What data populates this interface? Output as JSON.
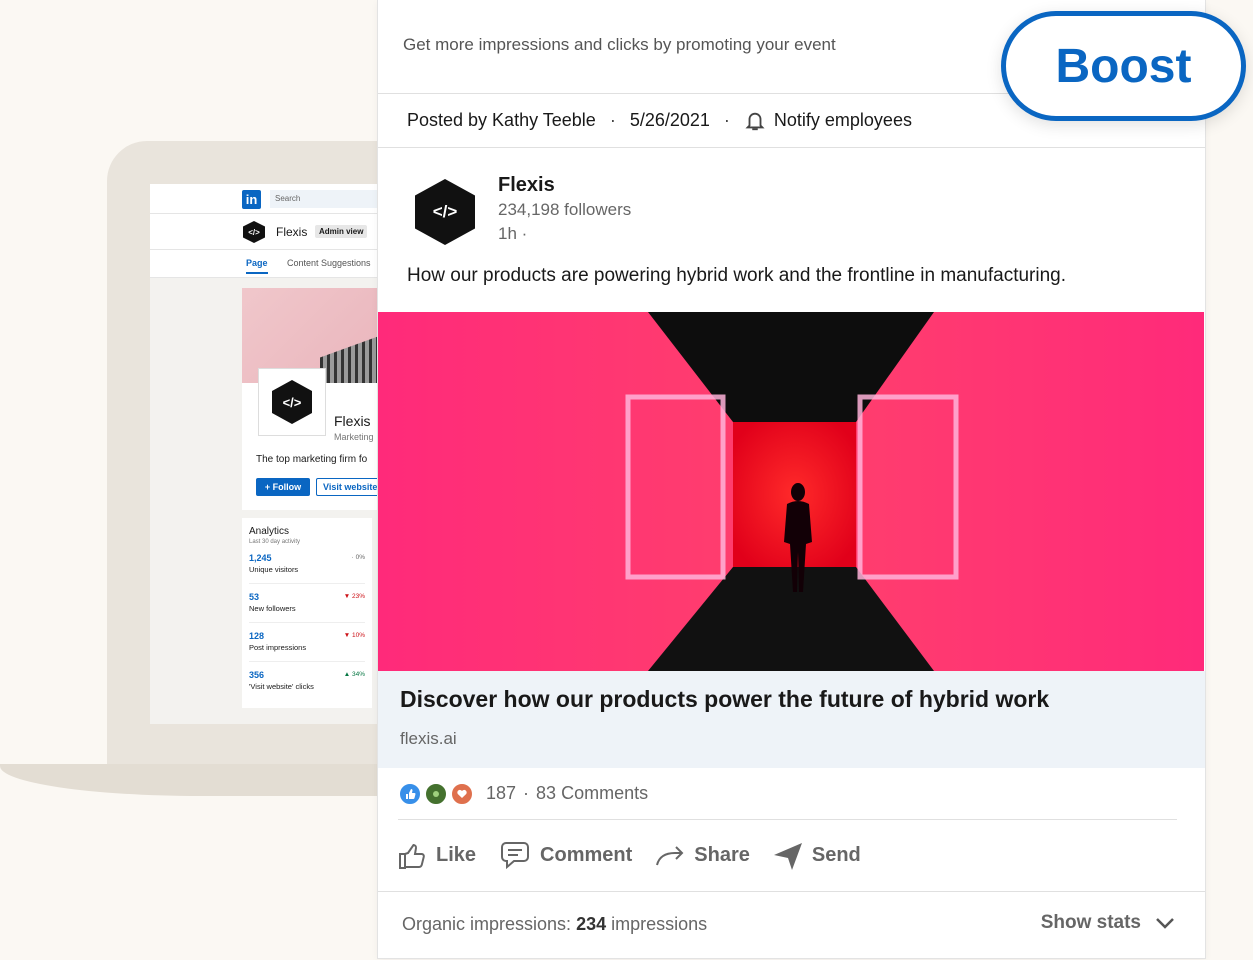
{
  "laptop": {
    "search_placeholder": "Search",
    "li_logo": "in",
    "company_name": "Flexis",
    "admin_badge": "Admin view",
    "logo_text": "</>",
    "tabs": [
      "Page",
      "Content Suggestions"
    ],
    "page_name": "Flexis",
    "page_subtitle": "Marketing",
    "tagline": "The top marketing firm fo",
    "follow_label": "+ Follow",
    "visit_label": "Visit website",
    "analytics": {
      "title": "Analytics",
      "subtitle": "Last 30 day activity",
      "stats": [
        {
          "value": "1,245",
          "label": "Unique visitors",
          "delta": "0%",
          "trend": "flat"
        },
        {
          "value": "53",
          "label": "New followers",
          "delta": "23%",
          "trend": "down"
        },
        {
          "value": "128",
          "label": "Post impressions",
          "delta": "10%",
          "trend": "down"
        },
        {
          "value": "356",
          "label": "'Visit website' clicks",
          "delta": "34%",
          "trend": "up"
        }
      ]
    }
  },
  "promo": {
    "text": "Get more impressions and clicks by promoting your event",
    "boost_label": "Boost"
  },
  "meta": {
    "posted_by": "Posted by Kathy Teeble",
    "date": "5/26/2021",
    "notify": "Notify employees"
  },
  "post": {
    "author": "Flexis",
    "logo_text": "</>",
    "followers": "234,198 followers",
    "time": "1h ·",
    "text": "How our products are powering hybrid work and the frontline in manufacturing.",
    "link_title": "Discover how our products power the future of hybrid work",
    "link_domain": "flexis.ai",
    "reactions_count": "187",
    "comments": "83 Comments",
    "actions": {
      "like": "Like",
      "comment": "Comment",
      "share": "Share",
      "send": "Send"
    }
  },
  "stats": {
    "organic_label": "Organic impressions:",
    "organic_value": "234",
    "organic_unit": "impressions",
    "show_stats": "Show stats"
  },
  "colors": {
    "accent": "#0a66c2",
    "hero_pink": "#ff1f6b",
    "hero_red": "#ff1a1a"
  }
}
